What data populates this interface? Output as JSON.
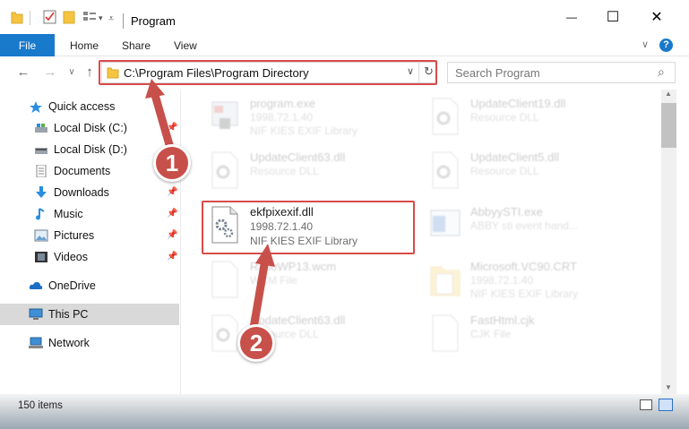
{
  "window": {
    "title": "Program",
    "minimize_glyph": "—",
    "maximize_glyph": "☐",
    "close_glyph": "✕"
  },
  "ribbon": {
    "tabs": [
      "File",
      "Home",
      "Share",
      "View"
    ],
    "expand_glyph": "∨",
    "help_glyph": "?"
  },
  "nav": {
    "back_glyph": "←",
    "forward_glyph": "→",
    "recent_glyph": "∨",
    "up_glyph": "↑",
    "address": "C:\\Program Files\\Program Directory",
    "refresh_glyph": "↻",
    "search_placeholder": "Search Program",
    "search_glyph": "⌕"
  },
  "sidebar": {
    "items": [
      {
        "label": "Quick access",
        "icon": "star-icon"
      },
      {
        "label": "Local Disk (C:)",
        "icon": "drive-icon",
        "pinned": true
      },
      {
        "label": "Local Disk (D:)",
        "icon": "drive-icon"
      },
      {
        "label": "Documents",
        "icon": "documents-icon"
      },
      {
        "label": "Downloads",
        "icon": "download-icon",
        "pinned": true
      },
      {
        "label": "Music",
        "icon": "music-icon",
        "pinned": true
      },
      {
        "label": "Pictures",
        "icon": "pictures-icon",
        "pinned": true
      },
      {
        "label": "Videos",
        "icon": "videos-icon",
        "pinned": true
      },
      {
        "label": "OneDrive",
        "icon": "cloud-icon"
      },
      {
        "label": "This PC",
        "icon": "computer-icon",
        "selected": true
      },
      {
        "label": "Network",
        "icon": "network-icon"
      }
    ]
  },
  "files": [
    {
      "name": "program.exe",
      "line2": "1998.72.1.40",
      "line3": "NIF KIES EXIF Library",
      "faded": true
    },
    {
      "name": "UpdateClient19.dll",
      "line2": "Resource DLL",
      "line3": "",
      "faded": true
    },
    {
      "name": "UpdateClient63.dll",
      "line2": "Resource DLL",
      "line3": "",
      "faded": true
    },
    {
      "name": "UpdateClient5.dll",
      "line2": "Resource DLL",
      "line3": "",
      "faded": true
    },
    {
      "name": "ekfpixexif.dll",
      "line2": "1998.72.1.40",
      "line3": "NIF KIES EXIF Library",
      "faded": false
    },
    {
      "name": "AbbyySTI.exe",
      "line2": "ABBY sti event hand...",
      "line3": "",
      "faded": true
    },
    {
      "name": "RatioWP13.wcm",
      "line2": "WCM File",
      "line3": "",
      "faded": true
    },
    {
      "name": "Microsoft.VC90.CRT",
      "line2": "1998.72.1.40",
      "line3": "NIF KIES EXIF Library",
      "faded": true
    },
    {
      "name": "UpdateClient63.dll",
      "line2": "Resource DLL",
      "line3": "",
      "faded": true
    },
    {
      "name": "FastHtml.cjk",
      "line2": "CJK File",
      "line3": "",
      "faded": true
    }
  ],
  "status": {
    "item_count": "150 items"
  },
  "annotations": {
    "badge1": "1",
    "badge2": "2"
  },
  "colors": {
    "accent": "#1979ca",
    "highlight": "#d84b4b",
    "badge": "#c8504a"
  }
}
